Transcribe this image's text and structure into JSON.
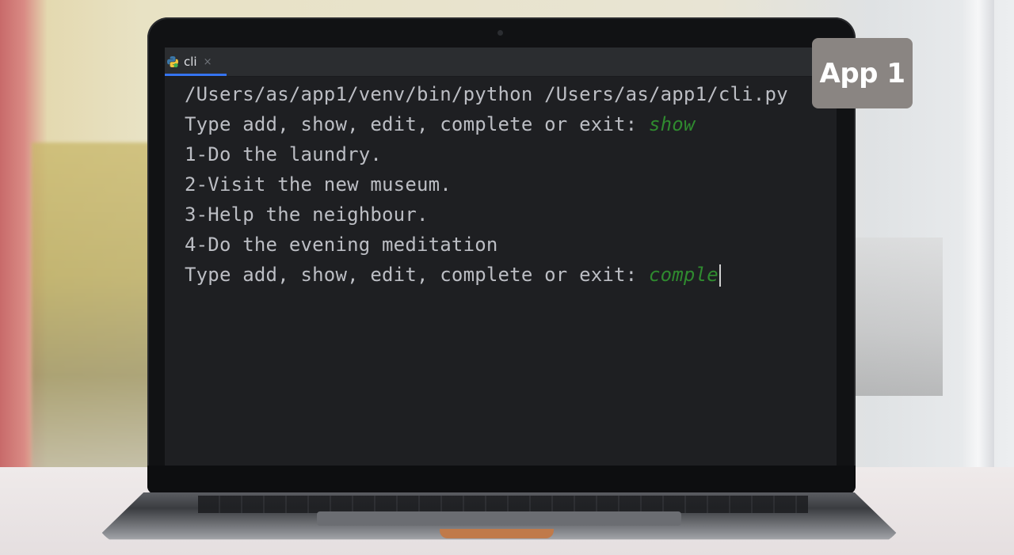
{
  "tab": {
    "label": "cli",
    "icon": "python-icon",
    "close_glyph": "×"
  },
  "console": {
    "lines": [
      {
        "text": "/Users/as/app1/venv/bin/python /Users/as/app1/cli.py",
        "input": ""
      },
      {
        "text": "Type add, show, edit, complete or exit: ",
        "input": "show"
      },
      {
        "text": "1-Do the laundry.",
        "input": ""
      },
      {
        "text": "2-Visit the new museum.",
        "input": ""
      },
      {
        "text": "3-Help the neighbour.",
        "input": ""
      },
      {
        "text": "4-Do the evening meditation",
        "input": ""
      },
      {
        "text": "Type add, show, edit, complete or exit: ",
        "input": "comple"
      }
    ]
  },
  "overlay": {
    "badge_label": "App 1"
  },
  "colors": {
    "console_text": "#bcbec4",
    "user_input": "#2f8a2f",
    "console_bg": "#1e1f22",
    "tab_accent": "#3574f0",
    "badge_bg": "#8a8582"
  }
}
